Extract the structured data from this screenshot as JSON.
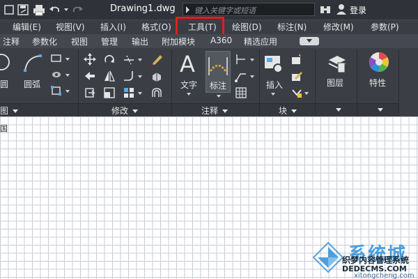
{
  "titlebar": {
    "document_title": "Drawing1.dwg",
    "search_placeholder": "键入关键字或短语",
    "login_label": "登录",
    "icons": [
      "save-icon",
      "plot-icon",
      "undo-icon",
      "binoculars-icon",
      "user-icon"
    ]
  },
  "menubar": {
    "items": [
      "编辑(E)",
      "视图(V)",
      "插入(I)",
      "格式(O)",
      "工具(T)",
      "绘图(D)",
      "标注(N)",
      "修改(M)",
      "参数(P)"
    ],
    "highlighted": "工具(T)",
    "highlight_color": "#e11f1f"
  },
  "tabs": [
    "注释",
    "参数化",
    "视图",
    "管理",
    "输出",
    "附加模块",
    "A360",
    "精选应用"
  ],
  "ribbon": {
    "draw": {
      "title": "图",
      "circle_label": "圆",
      "arc_label": "圆弧"
    },
    "modify": {
      "title": "修改"
    },
    "annotation": {
      "title": "注释",
      "text_label": "文字",
      "dim_label": "标注"
    },
    "block": {
      "title": "块",
      "insert_label": "插入"
    },
    "layers": {
      "label": "图层"
    },
    "properties": {
      "label": "特性"
    }
  },
  "drawing": {
    "corner_label": "国"
  },
  "watermark": {
    "big": "系统城",
    "line1": "织梦内容管理系统",
    "line2": "DEDECMS.COM",
    "line3": "xitongcheng.com"
  },
  "colors": {
    "titlebar_bg": "#2f3238",
    "ribbon_bg": "#3b3e45",
    "grid_line": "#c9ccd6",
    "accent_blue": "#2d8fd6"
  }
}
